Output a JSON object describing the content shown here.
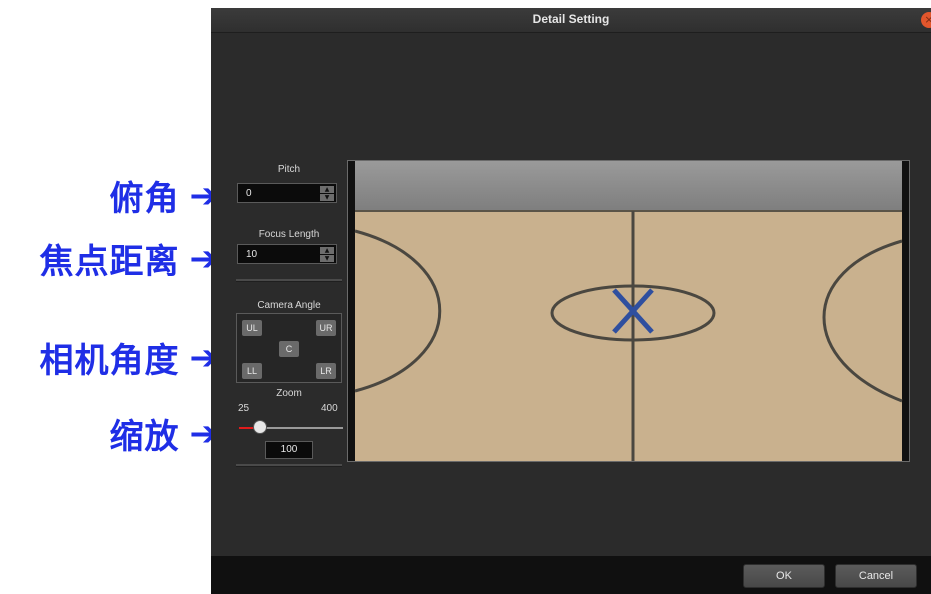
{
  "annotations": {
    "pitch": "俯角",
    "focus_length": "焦点距离",
    "camera_angle": "相机角度",
    "zoom": "缩放",
    "arrow": "➔"
  },
  "dialog": {
    "title": "Detail Setting",
    "close_icon": "×"
  },
  "pitch": {
    "label": "Pitch",
    "value": "0"
  },
  "focus_length": {
    "label": "Focus Length",
    "value": "10"
  },
  "spin_icons": {
    "up": "▲",
    "down": "▼"
  },
  "camera_angle": {
    "label": "Camera Angle",
    "buttons": {
      "ul": "UL",
      "ur": "UR",
      "c": "C",
      "ll": "LL",
      "lr": "LR"
    }
  },
  "zoom": {
    "label": "Zoom",
    "min_label": "25",
    "max_label": "400",
    "value": "100",
    "min": 25,
    "max": 400,
    "current": 100
  },
  "footer": {
    "ok": "OK",
    "cancel": "Cancel"
  },
  "colors": {
    "annotation": "#1f2ee6",
    "dialog_bg": "#2b2b2b",
    "court_floor": "#c9b18e",
    "court_stands": "#8c8c8c",
    "center_marker": "#2f4f9f",
    "slider_fill": "#e01b1b",
    "close_button": "#e2562c"
  }
}
